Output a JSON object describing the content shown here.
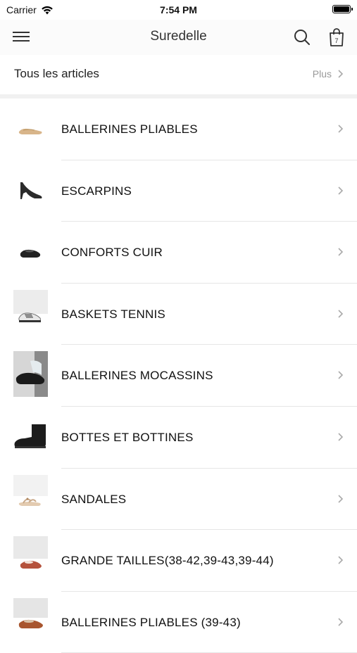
{
  "status_bar": {
    "carrier": "Carrier",
    "time": "7:54 PM"
  },
  "nav": {
    "title": "Suredelle",
    "cart_count": "7"
  },
  "all_articles": {
    "label": "Tous les articles",
    "more_label": "Plus"
  },
  "categories": [
    {
      "label": "BALLERINES PLIABLES",
      "thumb_icon": "ballerina-flat-shoe",
      "thumb_color": "#d8b58a"
    },
    {
      "label": "ESCARPINS",
      "thumb_icon": "high-heel-pump",
      "thumb_color": "#2b2b2b"
    },
    {
      "label": "CONFORTS CUIR",
      "thumb_icon": "leather-loafer",
      "thumb_color": "#222222"
    },
    {
      "label": "BASKETS TENNIS",
      "thumb_icon": "tennis-sneaker",
      "thumb_color": "#bbbbbb"
    },
    {
      "label": "BALLERINES MOCASSINS",
      "thumb_icon": "moccasin-ballerina",
      "thumb_color": "#1a1a1a"
    },
    {
      "label": "BOTTES ET BOTTINES",
      "thumb_icon": "ankle-boot",
      "thumb_color": "#1c1c1c"
    },
    {
      "label": "SANDALES",
      "thumb_icon": "sandal",
      "thumb_color": "#c9a98a"
    },
    {
      "label": "GRANDE TAILLES(38-42,39-43,39-44)",
      "thumb_icon": "red-ballerina",
      "thumb_color": "#b5523c"
    },
    {
      "label": "BALLERINES PLIABLES (39-43)",
      "thumb_icon": "brown-ballerina",
      "thumb_color": "#a8552e"
    }
  ]
}
